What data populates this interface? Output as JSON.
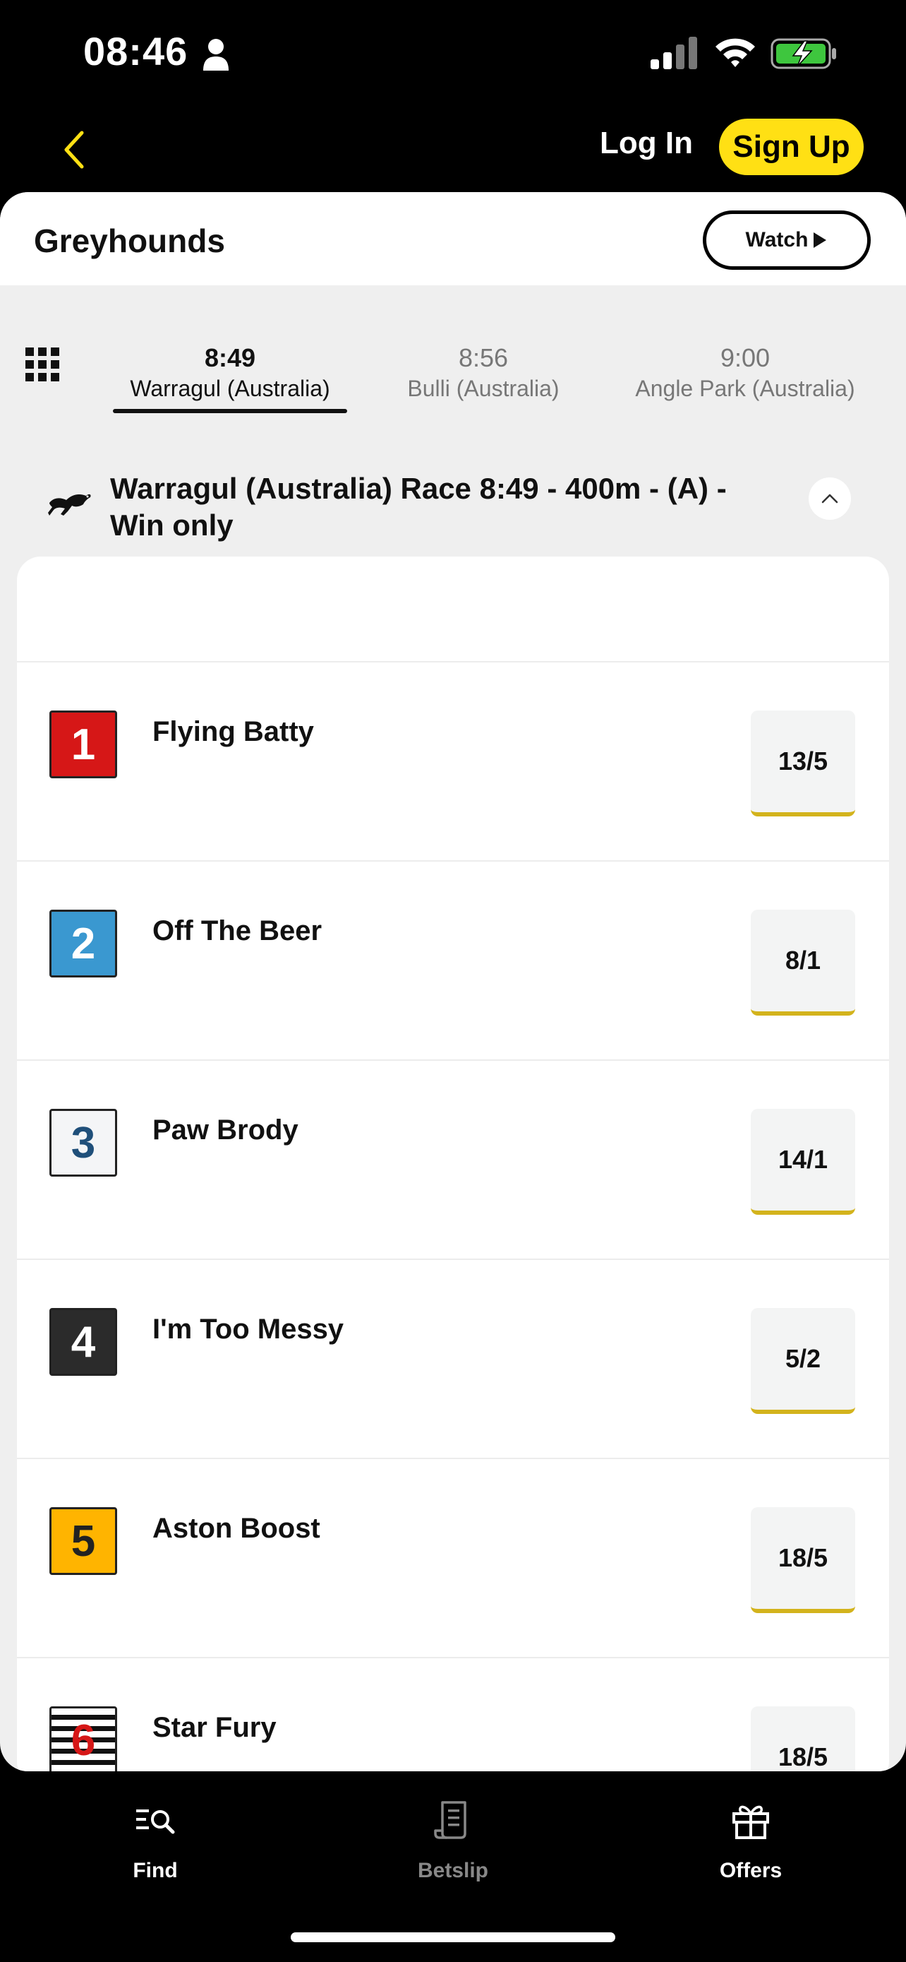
{
  "status_bar": {
    "time": "08:46"
  },
  "header": {
    "login_label": "Log In",
    "signup_label": "Sign Up",
    "accent_color": "#ffe014"
  },
  "page": {
    "title": "Greyhounds",
    "watch_label": "Watch"
  },
  "race_tabs": [
    {
      "time": "8:49",
      "venue": "Warragul (Australia)",
      "active": true
    },
    {
      "time": "8:56",
      "venue": "Bulli (Australia)",
      "active": false
    },
    {
      "time": "9:00",
      "venue": "Angle Park (Australia)",
      "active": false
    }
  ],
  "race": {
    "title": "Warragul (Australia) Race 8:49 - 400m - (A) - Win only"
  },
  "runners": [
    {
      "number": "1",
      "name": "Flying Batty",
      "odds": "13/5",
      "colour": "#d61717"
    },
    {
      "number": "2",
      "name": "Off The Beer",
      "odds": "8/1",
      "colour": "#3a98d0"
    },
    {
      "number": "3",
      "name": "Paw Brody",
      "odds": "14/1",
      "colour": "#f4f5f7"
    },
    {
      "number": "4",
      "name": "I'm Too Messy",
      "odds": "5/2",
      "colour": "#2b2b2b"
    },
    {
      "number": "5",
      "name": "Aston Boost",
      "odds": "18/5",
      "colour": "#ffb400"
    },
    {
      "number": "6",
      "name": "Star Fury",
      "odds": "18/5",
      "colour": "striped"
    }
  ],
  "bottom_nav": [
    {
      "label": "Find",
      "icon": "search-list-icon"
    },
    {
      "label": "Betslip",
      "icon": "receipt-icon"
    },
    {
      "label": "Offers",
      "icon": "gift-icon"
    }
  ]
}
